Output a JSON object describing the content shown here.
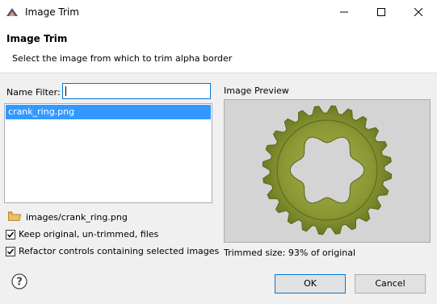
{
  "window": {
    "title": "Image Trim"
  },
  "header": {
    "title": "Image Trim",
    "description": "Select the image from which to trim alpha border"
  },
  "filter": {
    "label": "Name Filter:",
    "value": ""
  },
  "file_list": {
    "items": [
      "crank_ring.png"
    ],
    "selected_index": 0
  },
  "path": {
    "text": "images/crank_ring.png"
  },
  "options": {
    "keep_original": {
      "label": "Keep original, un-trimmed, files",
      "checked": true
    },
    "refactor_controls": {
      "label": "Refactor controls containing selected images",
      "checked": true
    }
  },
  "preview": {
    "label": "Image Preview",
    "trimmed_size": "Trimmed size: 93% of original",
    "image_description_icon": "gear-icon",
    "gear_color": "#7a8a2a"
  },
  "buttons": {
    "ok": "OK",
    "cancel": "Cancel"
  },
  "icons": {
    "app": "eclipse-icon",
    "minimize": "minimize-icon",
    "maximize": "maximize-icon",
    "close": "close-icon",
    "folder": "folder-icon",
    "help": "help-icon"
  }
}
